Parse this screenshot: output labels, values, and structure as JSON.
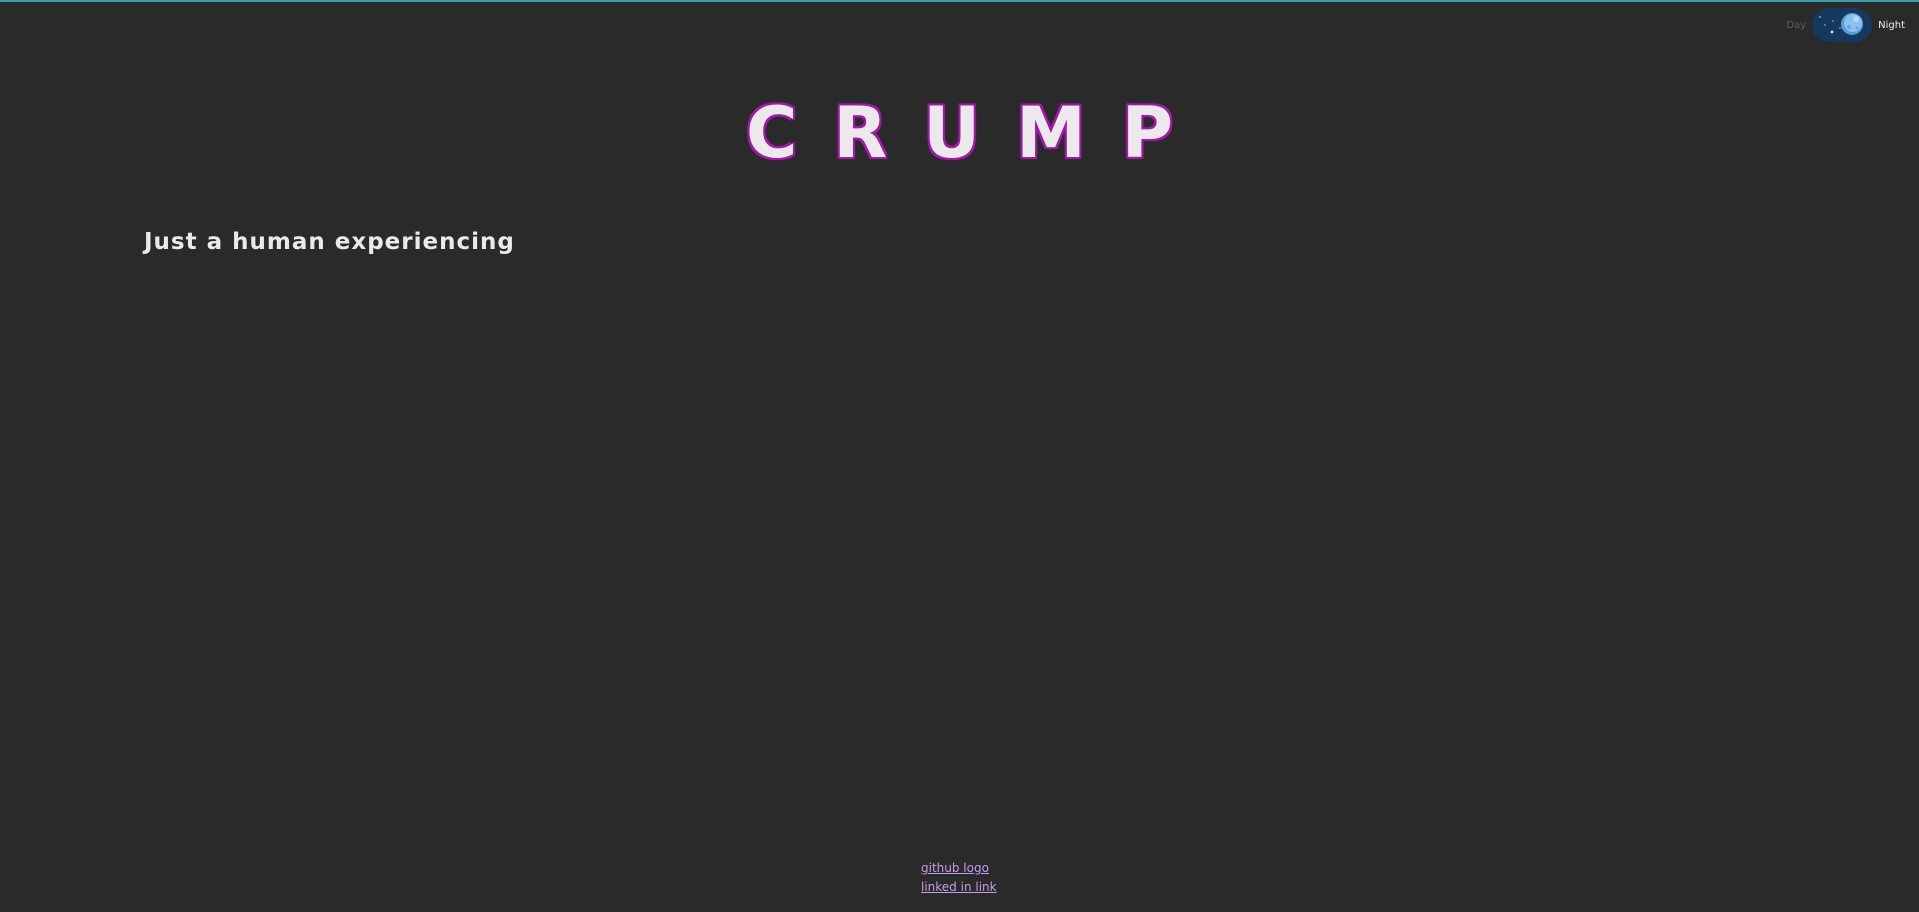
{
  "theme_toggle": {
    "day_label": "Day",
    "night_label": "Night",
    "state": "night"
  },
  "header": {
    "title": "CRUMP"
  },
  "main": {
    "tagline": "Just a human experiencing"
  },
  "footer": {
    "links": [
      {
        "label": "github logo"
      },
      {
        "label": "linked in link"
      }
    ]
  },
  "colors": {
    "background": "#2a2a2a",
    "title_fill": "#ece8ec",
    "title_outline": "#a01aa8",
    "link": "#c49ce8",
    "toggle_bg": "#16385f",
    "top_accent": "#3aa0b0"
  }
}
